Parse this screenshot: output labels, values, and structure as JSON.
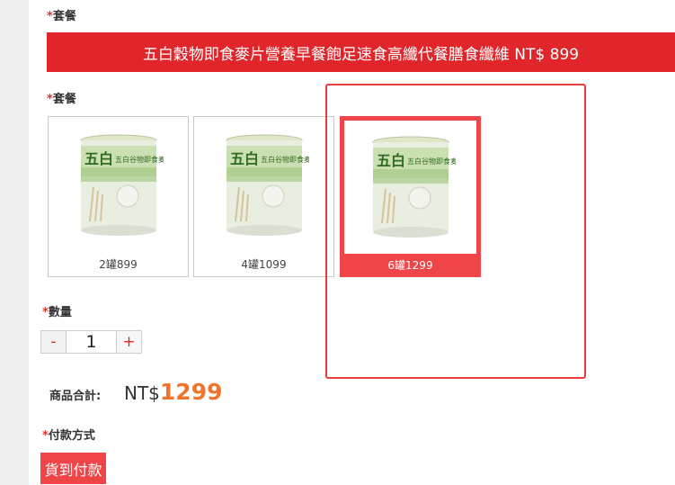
{
  "form": {
    "package_label": "套餐",
    "required_mark": "*",
    "banner_text": "五白穀物即食麥片營養早餐飽足速食高纖代餐膳食纖維 NT$ 899",
    "package_label_2": "套餐",
    "options": [
      {
        "caption": "2罐899",
        "selected": false,
        "product_text": "五白谷物即食麦片"
      },
      {
        "caption": "4罐1099",
        "selected": false,
        "product_text": "五白谷物即食麦片"
      },
      {
        "caption": "6罐1299",
        "selected": true,
        "product_text": "五白谷物即食麦片"
      }
    ],
    "quantity_label": "數量",
    "quantity": {
      "minus": "-",
      "value": "1",
      "plus": "+"
    },
    "total_label": "商品合計:",
    "total_currency": "NT$",
    "total_amount": "1299",
    "payment_label": "付款方式",
    "payment_button": "貨到付款"
  },
  "colors": {
    "accent": "#e1262b",
    "selected_card": "#ef4548",
    "price": "#f2742a",
    "highlight_box": "#ea3d3d"
  }
}
